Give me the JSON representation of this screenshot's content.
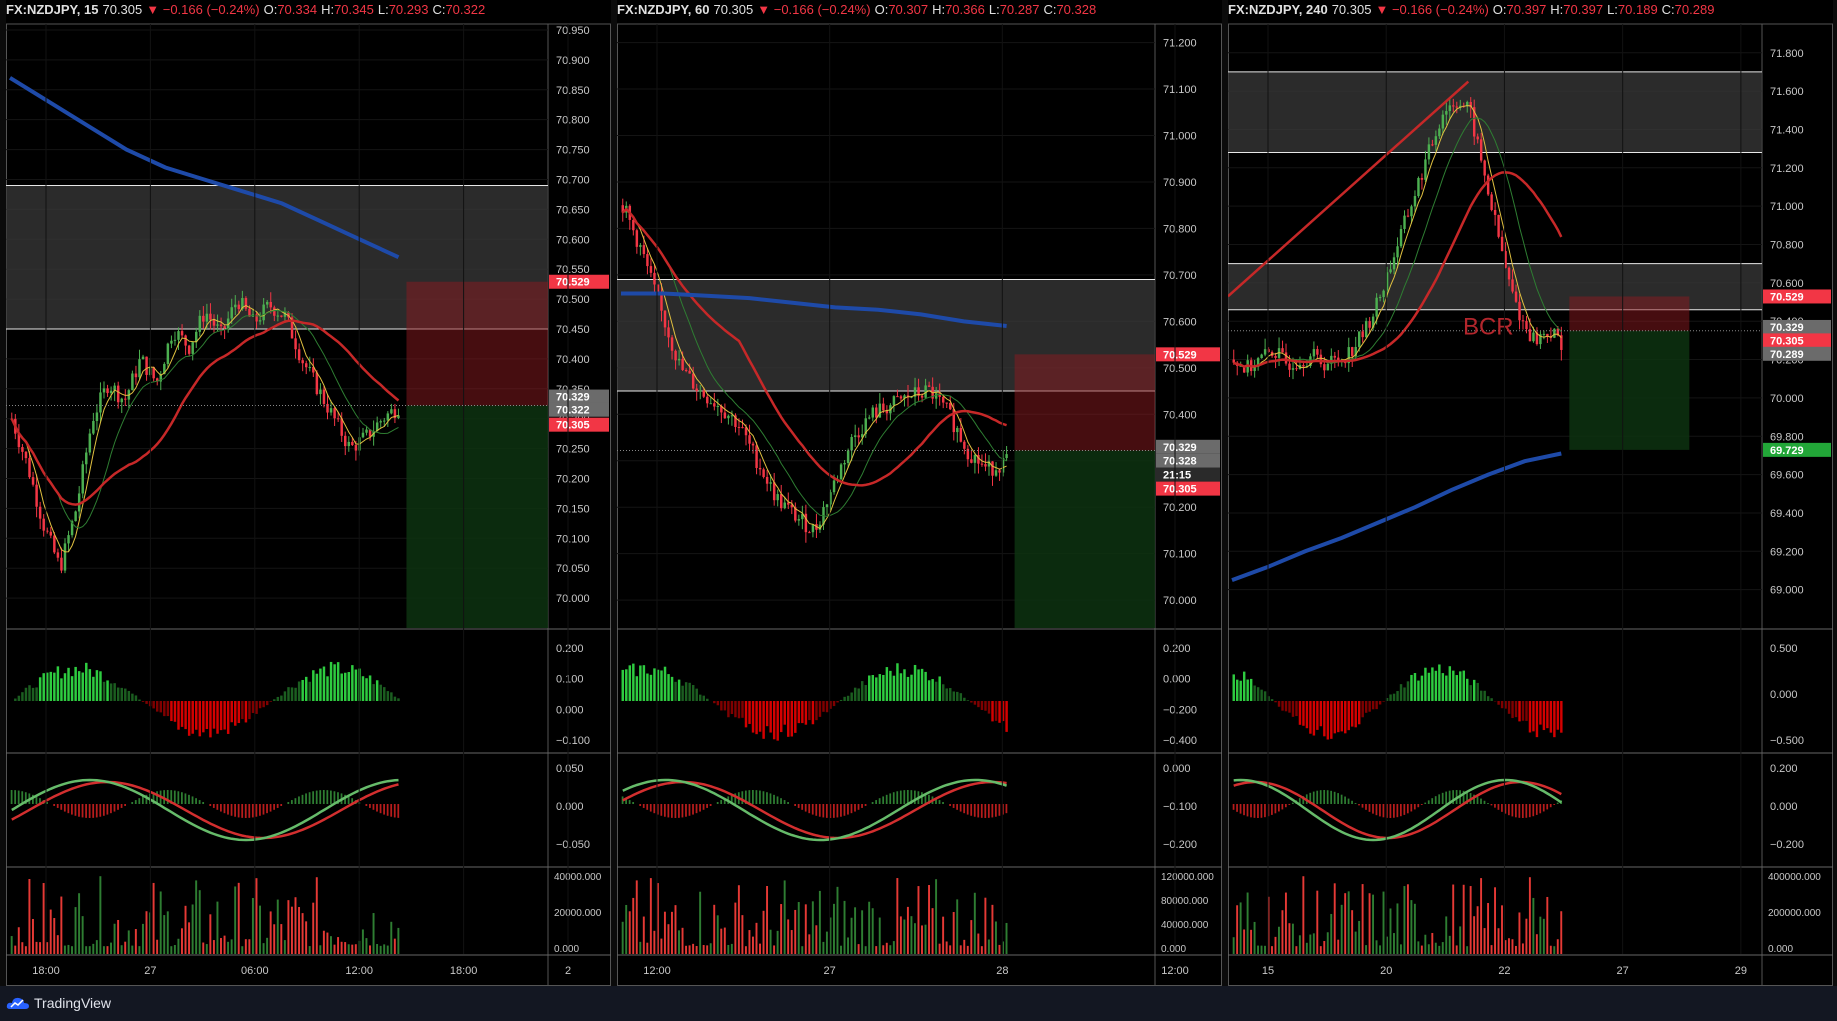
{
  "footer": {
    "brand": "TradingView",
    "logo_icon": "tradingview-cloud-icon"
  },
  "colors": {
    "up": "#4caf50",
    "down": "#f23645",
    "sma_slow": "#1e4aa8",
    "ema_red": "#c62828",
    "ema_green": "#2e7d32",
    "ema_yellow": "#e0c040",
    "zone": "#3a3a3a",
    "tp_zone": "#0d3311",
    "sl_zone": "#4a0d10"
  },
  "panels": [
    {
      "header": {
        "symbol": "FX:NZDJPY, 15",
        "last": "70.305",
        "change": "−0.166 (−0.24%)",
        "o_label": "O:",
        "o": "70.334",
        "h_label": "H:",
        "h": "70.345",
        "l_label": "L:",
        "l": "70.293",
        "c_label": "C:",
        "c": "70.322"
      },
      "chart_data": {
        "type": "candlestick",
        "timeframe": "15",
        "ylim": [
          69.95,
          70.96
        ],
        "y_ticks": [
          "70.950",
          "70.900",
          "70.850",
          "70.800",
          "70.750",
          "70.700",
          "70.650",
          "70.600",
          "70.550",
          "70.500",
          "70.450",
          "70.400",
          "70.350",
          "70.300",
          "70.250",
          "70.200",
          "70.150",
          "70.100",
          "70.050",
          "70.000"
        ],
        "y_tick_values": [
          70.95,
          70.9,
          70.85,
          70.8,
          70.75,
          70.7,
          70.65,
          70.6,
          70.55,
          70.5,
          70.45,
          70.4,
          70.35,
          70.3,
          70.25,
          70.2,
          70.15,
          70.1,
          70.05,
          70.0
        ],
        "x_ticks": [
          "18:00",
          "27",
          "06:00",
          "12:00",
          "18:00",
          "2"
        ],
        "price_path": [
          70.3,
          70.22,
          70.12,
          70.05,
          70.15,
          70.3,
          70.36,
          70.33,
          70.4,
          70.36,
          70.45,
          70.42,
          70.48,
          70.44,
          70.5,
          70.46,
          70.49,
          70.47,
          70.4,
          70.35,
          70.3,
          70.25,
          70.27,
          70.3,
          70.32
        ],
        "sma_slow": [
          70.87,
          70.83,
          70.79,
          70.75,
          70.72,
          70.7,
          70.68,
          70.66,
          70.63,
          70.6,
          70.57
        ],
        "zones": [
          {
            "top": 70.69,
            "bottom": 70.45
          }
        ],
        "position": {
          "entry": 70.322,
          "stop": 70.529,
          "target": 69.95
        },
        "price_labels": [
          {
            "text": "70.529",
            "value": 70.529,
            "color": "#f23645"
          },
          {
            "text": "70.329",
            "value": 70.337,
            "color": "#6b6b6b"
          },
          {
            "text": "70.322",
            "value": 70.315,
            "color": "#6b6b6b"
          },
          {
            "text": "70.305",
            "value": 70.29,
            "color": "#f23645"
          }
        ],
        "macd_ticks": [
          "0.200",
          "0.100",
          "0.000",
          "−0.100"
        ],
        "ao_ticks": [
          "0.050",
          "0.000",
          "−0.050"
        ],
        "vol_ticks": [
          "40000.000",
          "20000.000",
          "0.000"
        ]
      }
    },
    {
      "header": {
        "symbol": "FX:NZDJPY, 60",
        "last": "70.305",
        "change": "−0.166 (−0.24%)",
        "o_label": "O:",
        "o": "70.307",
        "h_label": "H:",
        "h": "70.366",
        "l_label": "L:",
        "l": "70.287",
        "c_label": "C:",
        "c": "70.328"
      },
      "chart_data": {
        "type": "candlestick",
        "timeframe": "60",
        "ylim": [
          69.94,
          71.24
        ],
        "y_ticks": [
          "71.200",
          "71.100",
          "71.000",
          "70.900",
          "70.800",
          "70.700",
          "70.600",
          "70.500",
          "70.400",
          "70.300",
          "70.200",
          "70.100",
          "70.000"
        ],
        "y_tick_values": [
          71.2,
          71.1,
          71.0,
          70.9,
          70.8,
          70.7,
          70.6,
          70.5,
          70.4,
          70.3,
          70.2,
          70.1,
          70.0
        ],
        "x_ticks": [
          "12:00",
          "27",
          "28",
          "12:00"
        ],
        "price_path": [
          70.85,
          70.75,
          70.62,
          70.5,
          70.45,
          70.42,
          70.38,
          70.3,
          70.22,
          70.18,
          70.15,
          70.25,
          70.35,
          70.4,
          70.42,
          70.44,
          70.45,
          70.4,
          70.32,
          70.28,
          70.3
        ],
        "sma_slow": [
          70.66,
          70.66,
          70.655,
          70.65,
          70.64,
          70.63,
          70.625,
          70.615,
          70.6,
          70.59
        ],
        "zones": [
          {
            "top": 70.69,
            "bottom": 70.45
          }
        ],
        "position": {
          "entry": 70.322,
          "stop": 70.529,
          "target": 69.94
        },
        "price_labels": [
          {
            "text": "70.529",
            "value": 70.529,
            "color": "#f23645"
          },
          {
            "text": "70.329",
            "value": 70.33,
            "color": "#6b6b6b"
          },
          {
            "text": "70.328",
            "value": 70.3,
            "color": "#6b6b6b"
          },
          {
            "text": "21:15",
            "value": 70.27,
            "color": "#2a2a2a"
          },
          {
            "text": "70.305",
            "value": 70.24,
            "color": "#f23645"
          }
        ],
        "macd_ticks": [
          "0.200",
          "0.000",
          "−0.200",
          "−0.400"
        ],
        "ao_ticks": [
          "0.000",
          "−0.100",
          "−0.200"
        ],
        "vol_ticks": [
          "120000.000",
          "80000.000",
          "40000.000",
          "0.000"
        ]
      }
    },
    {
      "header": {
        "symbol": "FX:NZDJPY, 240",
        "last": "70.305",
        "change": "−0.166 (−0.24%)",
        "o_label": "O:",
        "o": "70.397",
        "h_label": "H:",
        "h": "70.397",
        "l_label": "L:",
        "l": "70.189",
        "c_label": "C:",
        "c": "70.289"
      },
      "chart_data": {
        "type": "candlestick",
        "timeframe": "240",
        "ylim": [
          68.8,
          71.95
        ],
        "y_ticks": [
          "71.800",
          "71.600",
          "71.400",
          "71.200",
          "71.000",
          "70.800",
          "70.600",
          "70.400",
          "70.200",
          "70.000",
          "69.800",
          "69.600",
          "69.400",
          "69.200",
          "69.000"
        ],
        "y_tick_values": [
          71.8,
          71.6,
          71.4,
          71.2,
          71.0,
          70.8,
          70.6,
          70.4,
          70.2,
          70.0,
          69.8,
          69.6,
          69.4,
          69.2,
          69.0
        ],
        "x_ticks": [
          "15",
          "20",
          "22",
          "27",
          "29"
        ],
        "price_path": [
          70.2,
          70.15,
          70.2,
          70.25,
          70.18,
          70.2,
          70.22,
          70.18,
          70.2,
          70.25,
          70.35,
          70.5,
          70.7,
          70.9,
          71.1,
          71.3,
          71.5,
          71.55,
          71.5,
          71.2,
          70.9,
          70.6,
          70.4,
          70.3,
          70.35,
          70.29
        ],
        "sma_slow": [
          69.05,
          69.12,
          69.2,
          69.27,
          69.35,
          69.43,
          69.52,
          69.6,
          69.67,
          69.71
        ],
        "zones": [
          {
            "top": 71.7,
            "bottom": 71.28
          },
          {
            "top": 70.7,
            "bottom": 70.46
          }
        ],
        "position": {
          "entry": 70.35,
          "stop": 70.529,
          "target": 69.729
        },
        "annotation": "BCR",
        "price_labels": [
          {
            "text": "70.529",
            "value": 70.529,
            "color": "#f23645"
          },
          {
            "text": "70.329",
            "value": 70.37,
            "color": "#6b6b6b"
          },
          {
            "text": "70.305",
            "value": 70.3,
            "color": "#f23645"
          },
          {
            "text": "70.289",
            "value": 70.23,
            "color": "#6b6b6b"
          },
          {
            "text": "69.729",
            "value": 69.729,
            "color": "#22a638"
          }
        ],
        "macd_ticks": [
          "0.500",
          "0.000",
          "−0.500"
        ],
        "ao_ticks": [
          "0.200",
          "0.000",
          "−0.200"
        ],
        "vol_ticks": [
          "400000.000",
          "200000.000",
          "0.000"
        ]
      }
    }
  ]
}
